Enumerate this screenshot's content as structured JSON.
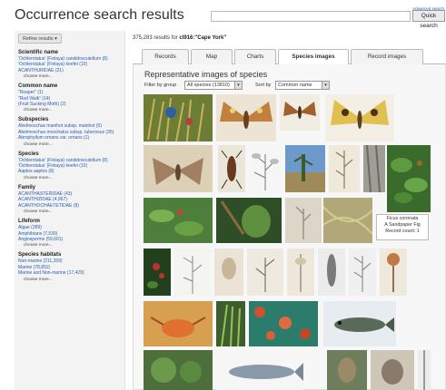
{
  "header": {
    "title": "Occurrence search results",
    "search_placeholder": "",
    "quick_search_label": "Quick search",
    "advanced_search_label": "Advanced search"
  },
  "sidebar": {
    "refine_label": "Refine results",
    "facets": [
      {
        "title": "Scientific name",
        "items": [
          "'Ochlerotatus' (Finlaya) candidoscutellum (8)",
          "'Ochlerotatus' (Finlaya) keefei (10)",
          "ACANTHURIDAE (21)"
        ],
        "more": "choose more..."
      },
      {
        "title": "Common name",
        "items": [
          "\"Reaper\" (1)",
          "\"Red Walk\" (14)",
          "(Fruit Sucking Moth) (2)"
        ],
        "more": "choose more..."
      },
      {
        "title": "Subspecies",
        "items": [
          "Abelmoschus manihot subsp. manihot (5)",
          "Abelmoschus moschatus subsp. tuberosus (35)",
          "Abrophyllum ornans var. ornans (1)"
        ],
        "more": "choose more..."
      },
      {
        "title": "Species",
        "items": [
          "'Ochlerotatus' (Finlaya) candidoscutellum (8)",
          "'Ochlerotatus' (Finlaya) keefei (10)",
          "Aaptos aaptos (8)"
        ],
        "more": "choose more..."
      },
      {
        "title": "Family",
        "items": [
          "ACANTHASTERIDAE (43)",
          "ACANTHIZIDAE (4,967)",
          "ACANTHOCHAETETIDAE (8)"
        ],
        "more": "choose more..."
      },
      {
        "title": "Lifeform",
        "items": [
          "Algae (289)",
          "Amphibians (7,539)",
          "Angiosperms (59,601)"
        ],
        "more": "choose more..."
      },
      {
        "title": "Species habitats",
        "items": [
          "Non-marine (211,359)",
          "Marine (78,852)",
          "Marine and Non-marine (17,429)"
        ],
        "more": "choose more..."
      }
    ]
  },
  "main": {
    "results_prefix": "375,283 results for ",
    "results_query": "cl916:\"Cape York\"",
    "tabs": [
      {
        "label": "Records",
        "active": false
      },
      {
        "label": "Map",
        "active": false
      },
      {
        "label": "Charts",
        "active": false
      },
      {
        "label": "Species images",
        "active": true
      },
      {
        "label": "Record images",
        "active": false
      }
    ],
    "panel_title": "Representative images of species",
    "filter_label": "Filter by group",
    "filter_value": "All species (13810)",
    "sort_label": "Sort by",
    "sort_value": "Common name"
  },
  "tooltip": {
    "lines": [
      "Ficus coronata",
      "A Sandpaper Fig",
      "Record count: 1"
    ]
  },
  "colors": {
    "link": "#2a5db0",
    "sidebar_bg": "#f3f3f3",
    "panel_bg": "#f7f7f7"
  }
}
